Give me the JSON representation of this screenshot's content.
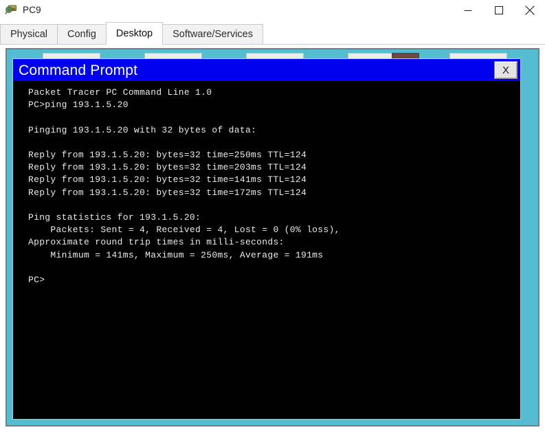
{
  "window": {
    "title": "PC9",
    "icon": "pc-device-icon",
    "controls": {
      "minimize": "minimize-icon",
      "maximize": "maximize-icon",
      "close": "close-icon"
    }
  },
  "tabs": [
    {
      "label": "Physical",
      "active": false
    },
    {
      "label": "Config",
      "active": false
    },
    {
      "label": "Desktop",
      "active": true
    },
    {
      "label": "Software/Services",
      "active": false
    }
  ],
  "desktop": {
    "background_color": "#55bcd2",
    "border_color": "#7d7d7d"
  },
  "command_prompt": {
    "title": "Command Prompt",
    "titlebar_color": "#0000ee",
    "close_button_label": "X",
    "background_color": "#000000",
    "text_color": "#eceae4",
    "output": "Packet Tracer PC Command Line 1.0\nPC>ping 193.1.5.20\n\nPinging 193.1.5.20 with 32 bytes of data:\n\nReply from 193.1.5.20: bytes=32 time=250ms TTL=124\nReply from 193.1.5.20: bytes=32 time=203ms TTL=124\nReply from 193.1.5.20: bytes=32 time=141ms TTL=124\nReply from 193.1.5.20: bytes=32 time=172ms TTL=124\n\nPing statistics for 193.1.5.20:\n    Packets: Sent = 4, Received = 4, Lost = 0 (0% loss),\nApproximate round trip times in milli-seconds:\n    Minimum = 141ms, Maximum = 250ms, Average = 191ms\n\nPC>",
    "details": {
      "banner": "Packet Tracer PC Command Line 1.0",
      "prompt": "PC>",
      "command": "ping 193.1.5.20",
      "target_host": "193.1.5.20",
      "payload_bytes": "32",
      "replies": [
        {
          "from": "193.1.5.20",
          "bytes": "32",
          "time": "250ms",
          "ttl": "124"
        },
        {
          "from": "193.1.5.20",
          "bytes": "32",
          "time": "203ms",
          "ttl": "124"
        },
        {
          "from": "193.1.5.20",
          "bytes": "32",
          "time": "141ms",
          "ttl": "124"
        },
        {
          "from": "193.1.5.20",
          "bytes": "32",
          "time": "172ms",
          "ttl": "124"
        }
      ],
      "statistics": {
        "sent": "4",
        "received": "4",
        "lost": "0",
        "loss_percent": "0%",
        "minimum": "141ms",
        "maximum": "250ms",
        "average": "191ms"
      }
    }
  }
}
